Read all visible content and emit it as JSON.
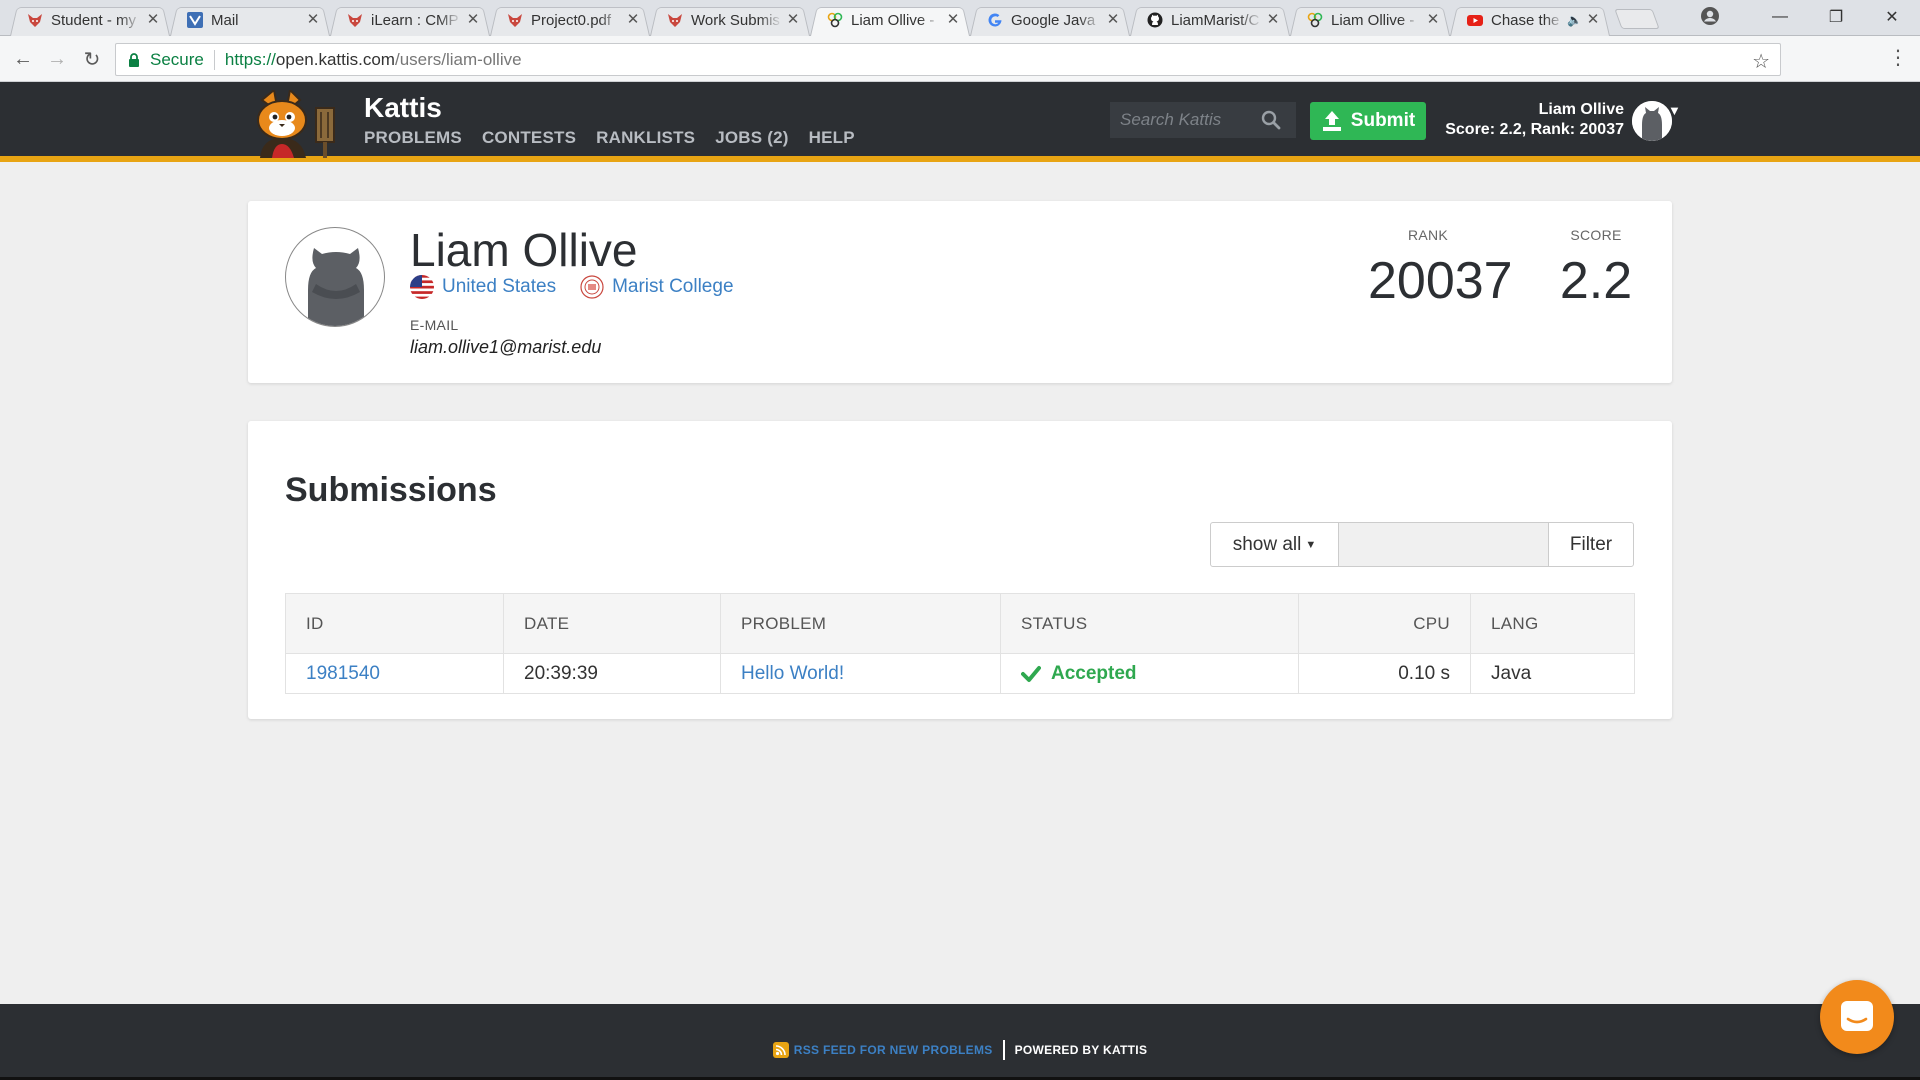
{
  "browser": {
    "tabs": [
      {
        "title": "Student - my",
        "icon": "fox-icon",
        "active": false
      },
      {
        "title": "Mail",
        "icon": "mail-icon",
        "active": false
      },
      {
        "title": "iLearn : CMP",
        "icon": "fox-icon",
        "active": false
      },
      {
        "title": "Project0.pdf",
        "icon": "fox-icon",
        "active": false
      },
      {
        "title": "Work Submis",
        "icon": "fox-icon",
        "active": false
      },
      {
        "title": "Liam Ollive -",
        "icon": "kattis-icon",
        "active": true
      },
      {
        "title": "Google Java",
        "icon": "google-icon",
        "active": false
      },
      {
        "title": "LiamMarist/C",
        "icon": "github-icon",
        "active": false
      },
      {
        "title": "Liam Ollive -",
        "icon": "kattis-icon",
        "active": false
      },
      {
        "title": "Chase the",
        "icon": "youtube-icon",
        "active": false,
        "audio": true
      }
    ],
    "secure_label": "Secure",
    "url_scheme": "https://",
    "url_host": "open.kattis.com",
    "url_path": "/users/liam-ollive"
  },
  "header": {
    "brand": "Kattis",
    "nav": [
      "PROBLEMS",
      "CONTESTS",
      "RANKLISTS",
      "JOBS (2)",
      "HELP"
    ],
    "search_placeholder": "Search Kattis",
    "submit_label": "Submit",
    "user_name": "Liam Ollive",
    "user_stats": "Score: 2.2, Rank: 20037"
  },
  "profile": {
    "name": "Liam Ollive",
    "country": "United States",
    "school": "Marist College",
    "email_label": "E-MAIL",
    "email": "liam.ollive1@marist.edu",
    "rank_label": "RANK",
    "rank": "20037",
    "score_label": "SCORE",
    "score": "2.2"
  },
  "submissions": {
    "title": "Submissions",
    "filter_select": "show all",
    "filter_button": "Filter",
    "columns": [
      "ID",
      "DATE",
      "PROBLEM",
      "STATUS",
      "CPU",
      "LANG"
    ],
    "rows": [
      {
        "id": "1981540",
        "date": "20:39:39",
        "problem": "Hello World!",
        "status": "Accepted",
        "cpu": "0.10 s",
        "lang": "Java"
      }
    ]
  },
  "footer": {
    "rss": "RSS FEED FOR NEW PROBLEMS",
    "powered": "POWERED BY KATTIS"
  },
  "colors": {
    "header_bg": "#2c2f33",
    "accent_stripe": "#e8a413",
    "submit_green": "#2fb755",
    "link_blue": "#3c80c4",
    "accepted_green": "#2fa84f",
    "chat_orange": "#f28a1b"
  }
}
